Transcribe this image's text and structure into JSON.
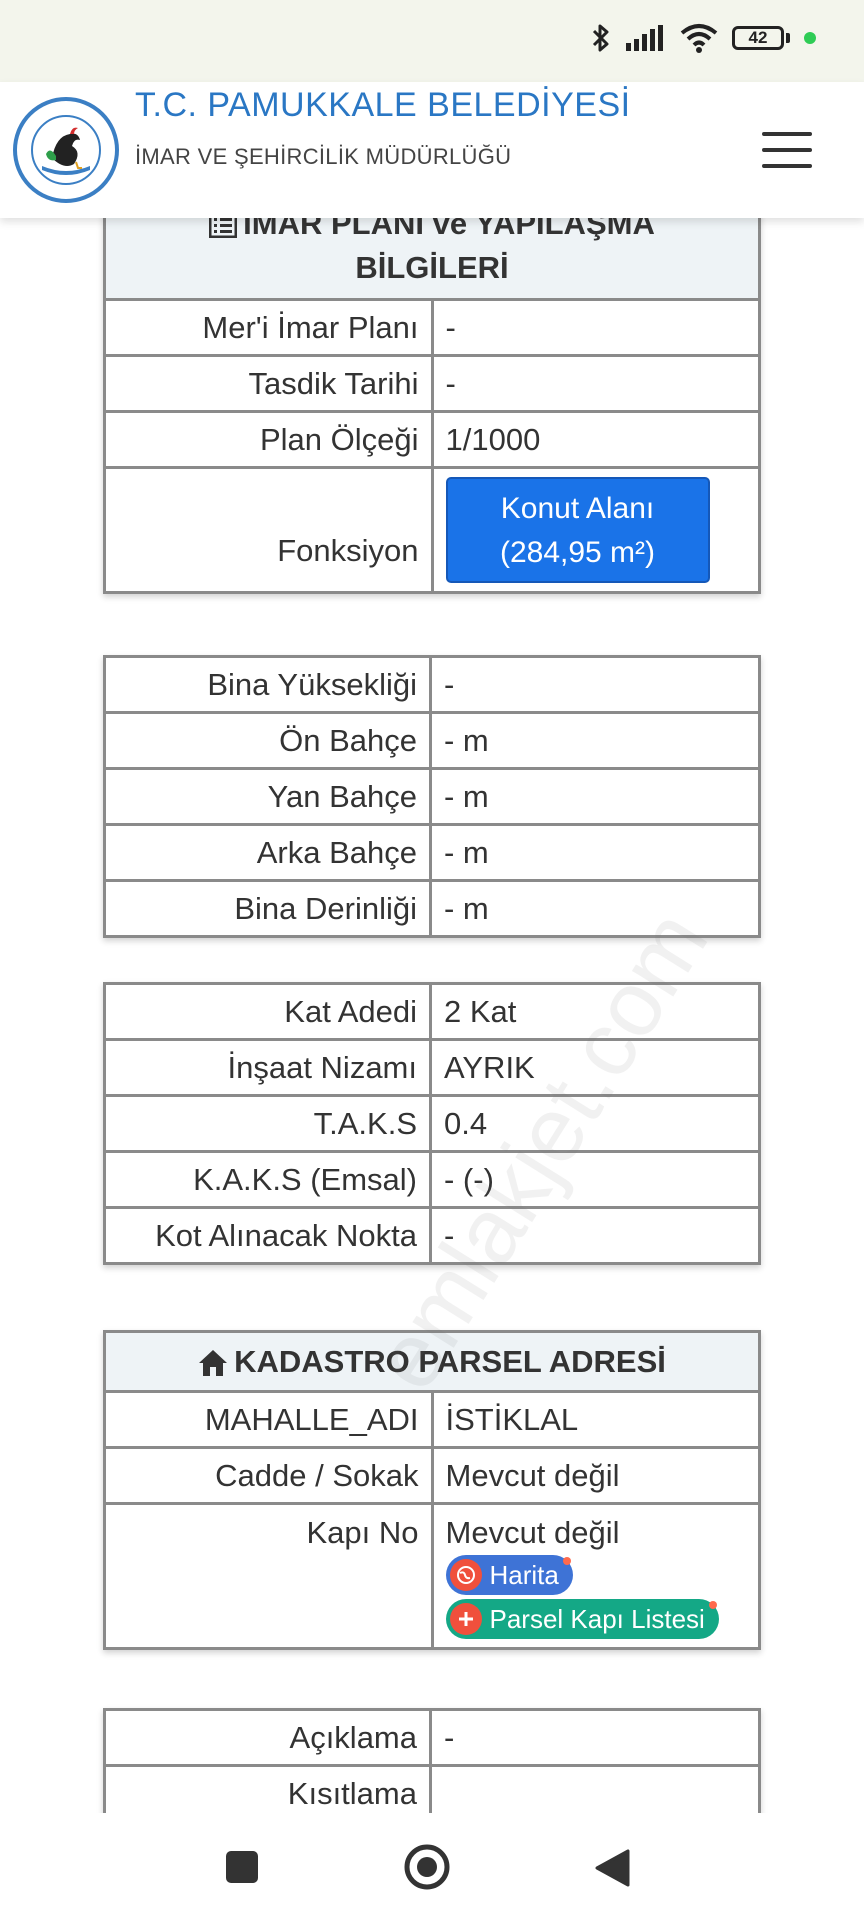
{
  "status_bar": {
    "battery": "42"
  },
  "header": {
    "title": "T.C. PAMUKKALE BELEDİYESİ",
    "subtitle": "İMAR VE ŞEHİRCİLİK MÜDÜRLÜĞÜ",
    "logo_text": "TÜRKİYE CUMHURİYETİ PAMUKKALE BELEDİYESİ"
  },
  "imar": {
    "title_line1": "İMAR PLANI ve YAPILAŞMA",
    "title_line2": "BİLGİLERİ",
    "rows": [
      {
        "label": "Mer'i İmar Planı",
        "value": "-"
      },
      {
        "label": "Tasdik Tarihi",
        "value": "-"
      },
      {
        "label": "Plan Ölçeği",
        "value": "1/1000"
      }
    ],
    "fonksiyon_label": "Fonksiyon",
    "fonksiyon_line1": "Konut Alanı",
    "fonksiyon_line2": "(284,95 m²)"
  },
  "yapi": {
    "rows": [
      {
        "label": "Bina Yüksekliği",
        "value": "-"
      },
      {
        "label": "Ön Bahçe",
        "value": "- m"
      },
      {
        "label": "Yan Bahçe",
        "value": "- m"
      },
      {
        "label": "Arka Bahçe",
        "value": "- m"
      },
      {
        "label": "Bina Derinliği",
        "value": "- m"
      }
    ]
  },
  "kat": {
    "rows": [
      {
        "label": "Kat Adedi",
        "value": "2 Kat"
      },
      {
        "label": "İnşaat Nizamı",
        "value": "AYRIK"
      },
      {
        "label": "T.A.K.S",
        "value": "0.4"
      },
      {
        "label": "K.A.K.S (Emsal)",
        "value": "- (-)"
      },
      {
        "label": "Kot Alınacak Nokta",
        "value": "-"
      }
    ]
  },
  "kadastro": {
    "title": "KADASTRO PARSEL ADRESİ",
    "rows": [
      {
        "label": "MAHALLE_ADI",
        "value": "İSTİKLAL"
      },
      {
        "label": "Cadde / Sokak",
        "value": "Mevcut değil"
      }
    ],
    "kapi_label": "Kapı No",
    "kapi_value": "Mevcut değil",
    "harita_label": "Harita",
    "parsel_label": "Parsel Kapı Listesi"
  },
  "aciklama": {
    "rows": [
      {
        "label": "Açıklama",
        "value": "-"
      },
      {
        "label": "Kısıtlama",
        "value": ""
      }
    ]
  },
  "watermark": "emlakjet.com",
  "colors": {
    "brand": "#2a77c4",
    "button": "#1a73e8",
    "harita": "#3e73d6",
    "parsel": "#14a886"
  }
}
